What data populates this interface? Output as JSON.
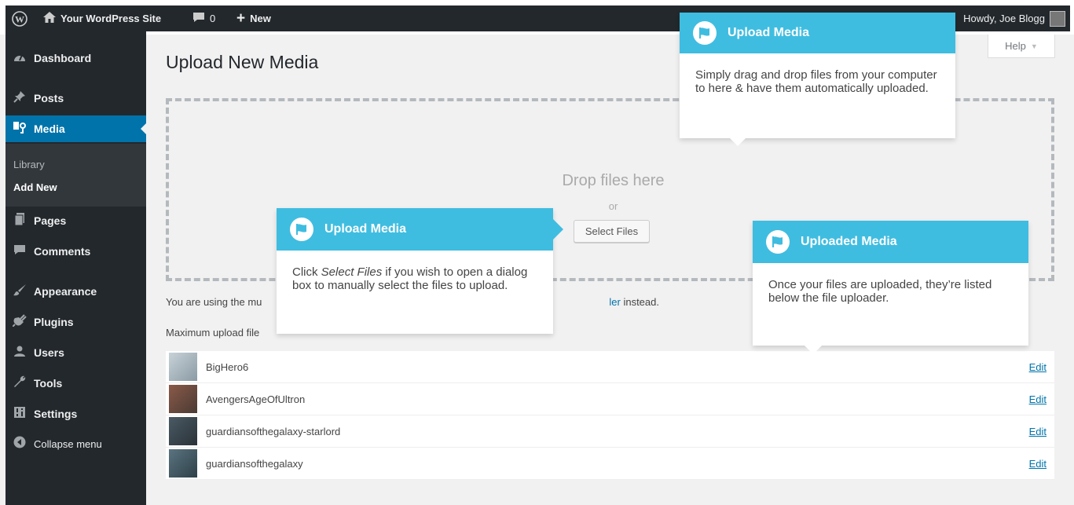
{
  "adminbar": {
    "site_name": "Your WordPress Site",
    "comments_count": "0",
    "new_label": "New",
    "howdy": "Howdy, Joe Blogg"
  },
  "sidebar": {
    "items": [
      {
        "label": "Dashboard",
        "icon": "dashboard-icon"
      },
      {
        "label": "Posts",
        "icon": "pin-icon"
      },
      {
        "label": "Media",
        "icon": "media-icon"
      },
      {
        "label": "Pages",
        "icon": "pages-icon"
      },
      {
        "label": "Comments",
        "icon": "comment-icon"
      },
      {
        "label": "Appearance",
        "icon": "brush-icon"
      },
      {
        "label": "Plugins",
        "icon": "plug-icon"
      },
      {
        "label": "Users",
        "icon": "users-icon"
      },
      {
        "label": "Tools",
        "icon": "wrench-icon"
      },
      {
        "label": "Settings",
        "icon": "settings-icon"
      }
    ],
    "submenu": [
      "Library",
      "Add New"
    ],
    "collapse_label": "Collapse menu"
  },
  "main": {
    "title": "Upload New Media",
    "help_label": "Help",
    "drop_text": "Drop files here",
    "or_text": "or",
    "select_button": "Select Files",
    "note_prefix": "You are using the mu",
    "note_link": "ler",
    "note_suffix": " instead.",
    "max_upload": "Maximum upload file"
  },
  "media": [
    {
      "name": "BigHero6",
      "edit": "Edit",
      "thumb_color": "#b8c4cc"
    },
    {
      "name": "AvengersAgeOfUltron",
      "edit": "Edit",
      "thumb_color": "#7a4a3a"
    },
    {
      "name": "guardiansofthegalaxy-starlord",
      "edit": "Edit",
      "thumb_color": "#3a4a55"
    },
    {
      "name": "guardiansofthegalaxy",
      "edit": "Edit",
      "thumb_color": "#4a6470"
    }
  ],
  "pointers": {
    "upload_top": {
      "title": "Upload Media",
      "body": "Simply drag and drop files from your computer to here & have them automatically uploaded."
    },
    "upload_select": {
      "title": "Upload Media",
      "body_prefix": "Click ",
      "body_em": "Select Files",
      "body_suffix": " if you wish to open a dialog box to manually select the files to upload."
    },
    "uploaded": {
      "title": "Uploaded Media",
      "body": "Once your files are uploaded, they’re listed below the file uploader."
    }
  },
  "colors": {
    "accent": "#0073aa",
    "pointer_header": "#3fbde0",
    "sidebar_bg": "#23282d"
  }
}
